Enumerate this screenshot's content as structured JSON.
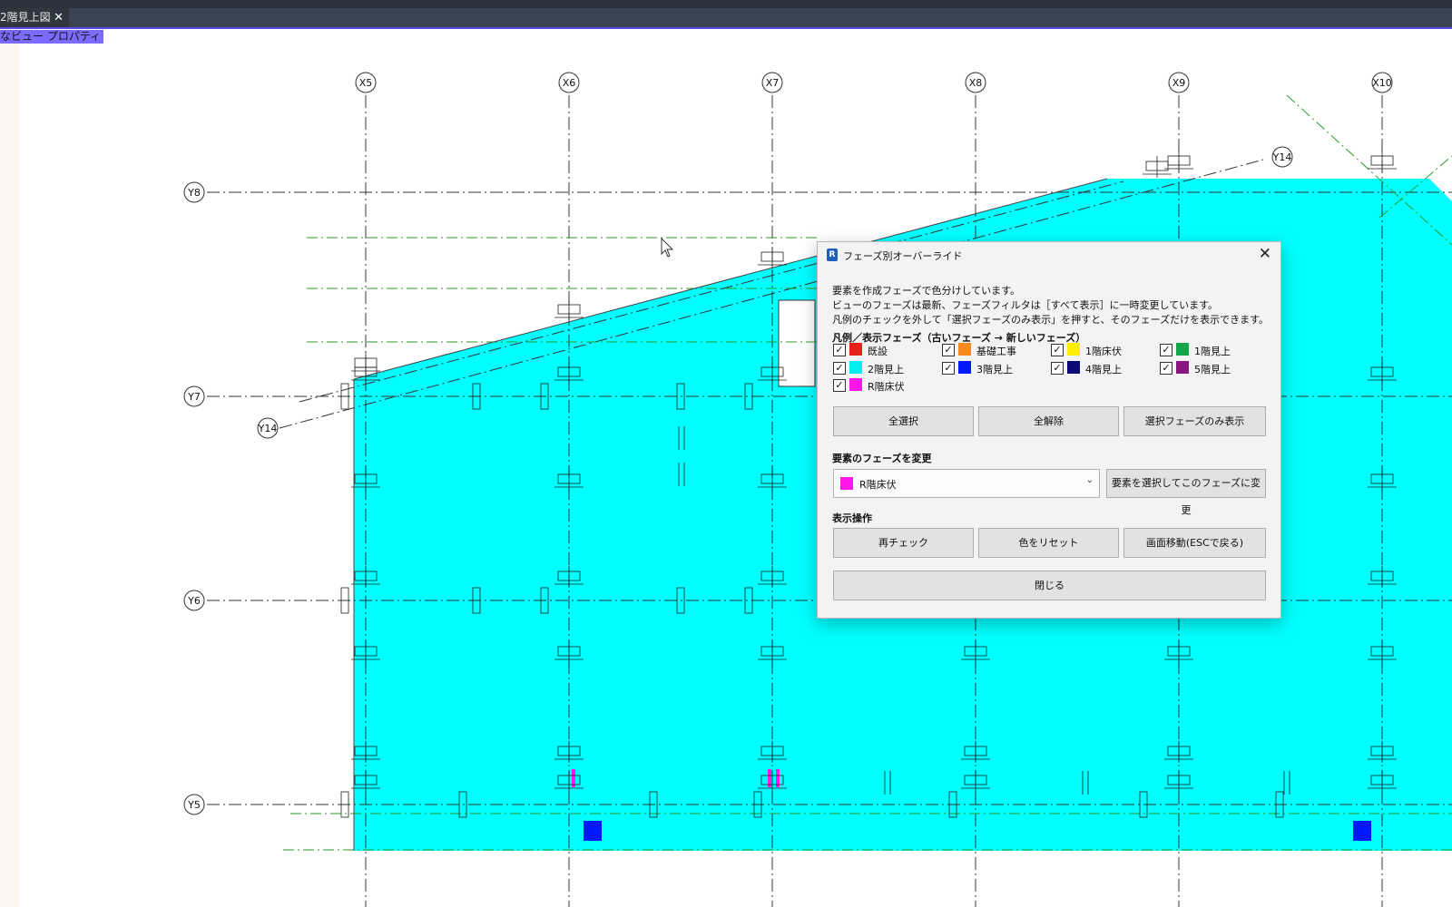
{
  "tab": {
    "title": "2階見上図",
    "close_glyph": "✕"
  },
  "properties_label": "なビュー プロパティ",
  "grid": {
    "x_labels": [
      "X5",
      "X6",
      "X7",
      "X8",
      "X9",
      "X10"
    ],
    "y_labels": [
      "Y8",
      "Y7",
      "Y6",
      "Y5"
    ],
    "diag_labels": [
      "Y14",
      "Y14"
    ]
  },
  "colors": {
    "fill": "#00ffff",
    "accent": "#5b49e6"
  },
  "dialog": {
    "title": "フェーズ別オーバーライド",
    "close_glyph": "✕",
    "description": [
      "要素を作成フェーズで色分けしています。",
      "ビューのフェーズは最新、フェーズフィルタは［すべて表示］に一時変更しています。",
      "凡例のチェックを外して「選択フェーズのみ表示」を押すと、そのフェーズだけを表示できます。"
    ],
    "legend_title": "凡例／表示フェーズ（古いフェーズ → 新しいフェーズ）",
    "legend": [
      {
        "label": "既設",
        "color": "#e8201c",
        "checked": true
      },
      {
        "label": "基礎工事",
        "color": "#f58a1f",
        "checked": true
      },
      {
        "label": "1階床伏",
        "color": "#ffee00",
        "checked": true
      },
      {
        "label": "1階見上",
        "color": "#16a64a",
        "checked": true
      },
      {
        "label": "2階見上",
        "color": "#00f0f0",
        "checked": true
      },
      {
        "label": "3階見上",
        "color": "#0018ff",
        "checked": true
      },
      {
        "label": "4階見上",
        "color": "#0a0a78",
        "checked": true
      },
      {
        "label": "5階見上",
        "color": "#8a1680",
        "checked": true
      },
      {
        "label": "R階床伏",
        "color": "#ff19e8",
        "checked": true
      }
    ],
    "check_glyph": "✓",
    "buttons_row1": [
      "全選択",
      "全解除",
      "選択フェーズのみ表示"
    ],
    "change_section": "要素のフェーズを変更",
    "selected_phase": {
      "label": "R階床伏",
      "color": "#ff19e8"
    },
    "chevron_glyph": "⌄",
    "apply_button": "要素を選択してこのフェーズに変更",
    "display_section": "表示操作",
    "buttons_row3": [
      "再チェック",
      "色をリセット",
      "画面移動(ESCで戻る)"
    ],
    "close_button": "閉じる"
  }
}
